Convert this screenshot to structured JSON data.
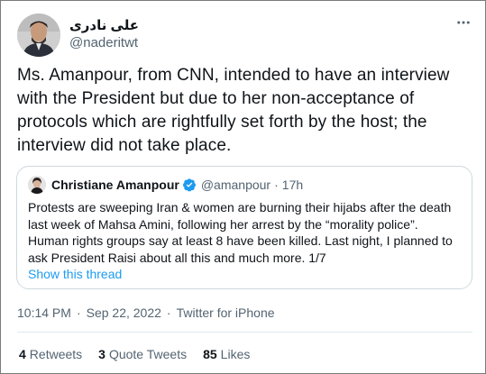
{
  "author": {
    "name": "علی نادری",
    "handle": "@naderitwt"
  },
  "tweet": {
    "text": "Ms. Amanpour, from CNN, intended to have an interview with the President but due to her non-acceptance of protocols which are rightfully set forth by the host; the interview did not take place."
  },
  "quoted": {
    "name": "Christiane Amanpour",
    "handle": "@amanpour",
    "dot": "·",
    "time": "17h",
    "text": "Protests are sweeping Iran & women are burning their hijabs after the death last week of Mahsa Amini, following her arrest by the “morality police”. Human rights groups say at least 8 have been killed. Last night, I planned to ask President Raisi about all this and much more. 1/7",
    "show_thread": "Show this thread"
  },
  "meta": {
    "time": "10:14 PM",
    "sep1": "·",
    "date": "Sep 22, 2022",
    "sep2": "·",
    "source": "Twitter for iPhone"
  },
  "stats": {
    "retweets_count": "4",
    "retweets_label": "Retweets",
    "quotes_count": "3",
    "quotes_label": "Quote Tweets",
    "likes_count": "85",
    "likes_label": "Likes"
  },
  "colors": {
    "accent": "#1d9bf0",
    "verified": "#1d9bf0",
    "secondary_text": "#536471"
  },
  "icons": {
    "more": "more-horizontal-icon",
    "verified": "verified-badge-icon"
  }
}
